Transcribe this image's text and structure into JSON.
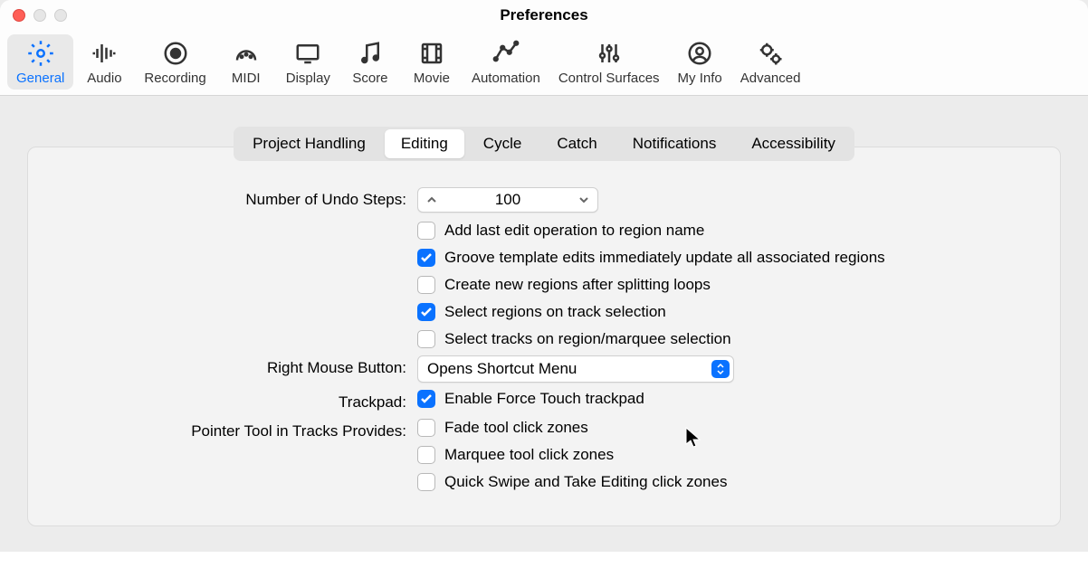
{
  "window": {
    "title": "Preferences"
  },
  "toolbar": [
    {
      "id": "general",
      "label": "General",
      "active": true
    },
    {
      "id": "audio",
      "label": "Audio",
      "active": false
    },
    {
      "id": "recording",
      "label": "Recording",
      "active": false
    },
    {
      "id": "midi",
      "label": "MIDI",
      "active": false
    },
    {
      "id": "display",
      "label": "Display",
      "active": false
    },
    {
      "id": "score",
      "label": "Score",
      "active": false
    },
    {
      "id": "movie",
      "label": "Movie",
      "active": false
    },
    {
      "id": "automation",
      "label": "Automation",
      "active": false
    },
    {
      "id": "control-surfaces",
      "label": "Control Surfaces",
      "active": false
    },
    {
      "id": "my-info",
      "label": "My Info",
      "active": false
    },
    {
      "id": "advanced",
      "label": "Advanced",
      "active": false
    }
  ],
  "subtabs": [
    {
      "id": "project-handling",
      "label": "Project Handling",
      "active": false
    },
    {
      "id": "editing",
      "label": "Editing",
      "active": true
    },
    {
      "id": "cycle",
      "label": "Cycle",
      "active": false
    },
    {
      "id": "catch",
      "label": "Catch",
      "active": false
    },
    {
      "id": "notifications",
      "label": "Notifications",
      "active": false
    },
    {
      "id": "accessibility",
      "label": "Accessibility",
      "active": false
    }
  ],
  "form": {
    "undo_label": "Number of Undo Steps:",
    "undo_value": "100",
    "cb_add_last": "Add last edit operation to region name",
    "cb_groove": "Groove template edits immediately update all associated regions",
    "cb_create_regions": "Create new regions after splitting loops",
    "cb_select_regions": "Select regions on track selection",
    "cb_select_tracks": "Select tracks on region/marquee selection",
    "rmb_label": "Right Mouse Button:",
    "rmb_value": "Opens Shortcut Menu",
    "trackpad_label": "Trackpad:",
    "cb_trackpad": "Enable Force Touch trackpad",
    "pointer_label": "Pointer Tool in Tracks Provides:",
    "cb_fade": "Fade tool click zones",
    "cb_marquee": "Marquee tool click zones",
    "cb_quickswipe": "Quick Swipe and Take Editing click zones"
  },
  "checked": {
    "add_last": false,
    "groove": true,
    "create_regions": false,
    "select_regions": true,
    "select_tracks": false,
    "trackpad": true,
    "fade": false,
    "marquee": false,
    "quickswipe": false
  }
}
